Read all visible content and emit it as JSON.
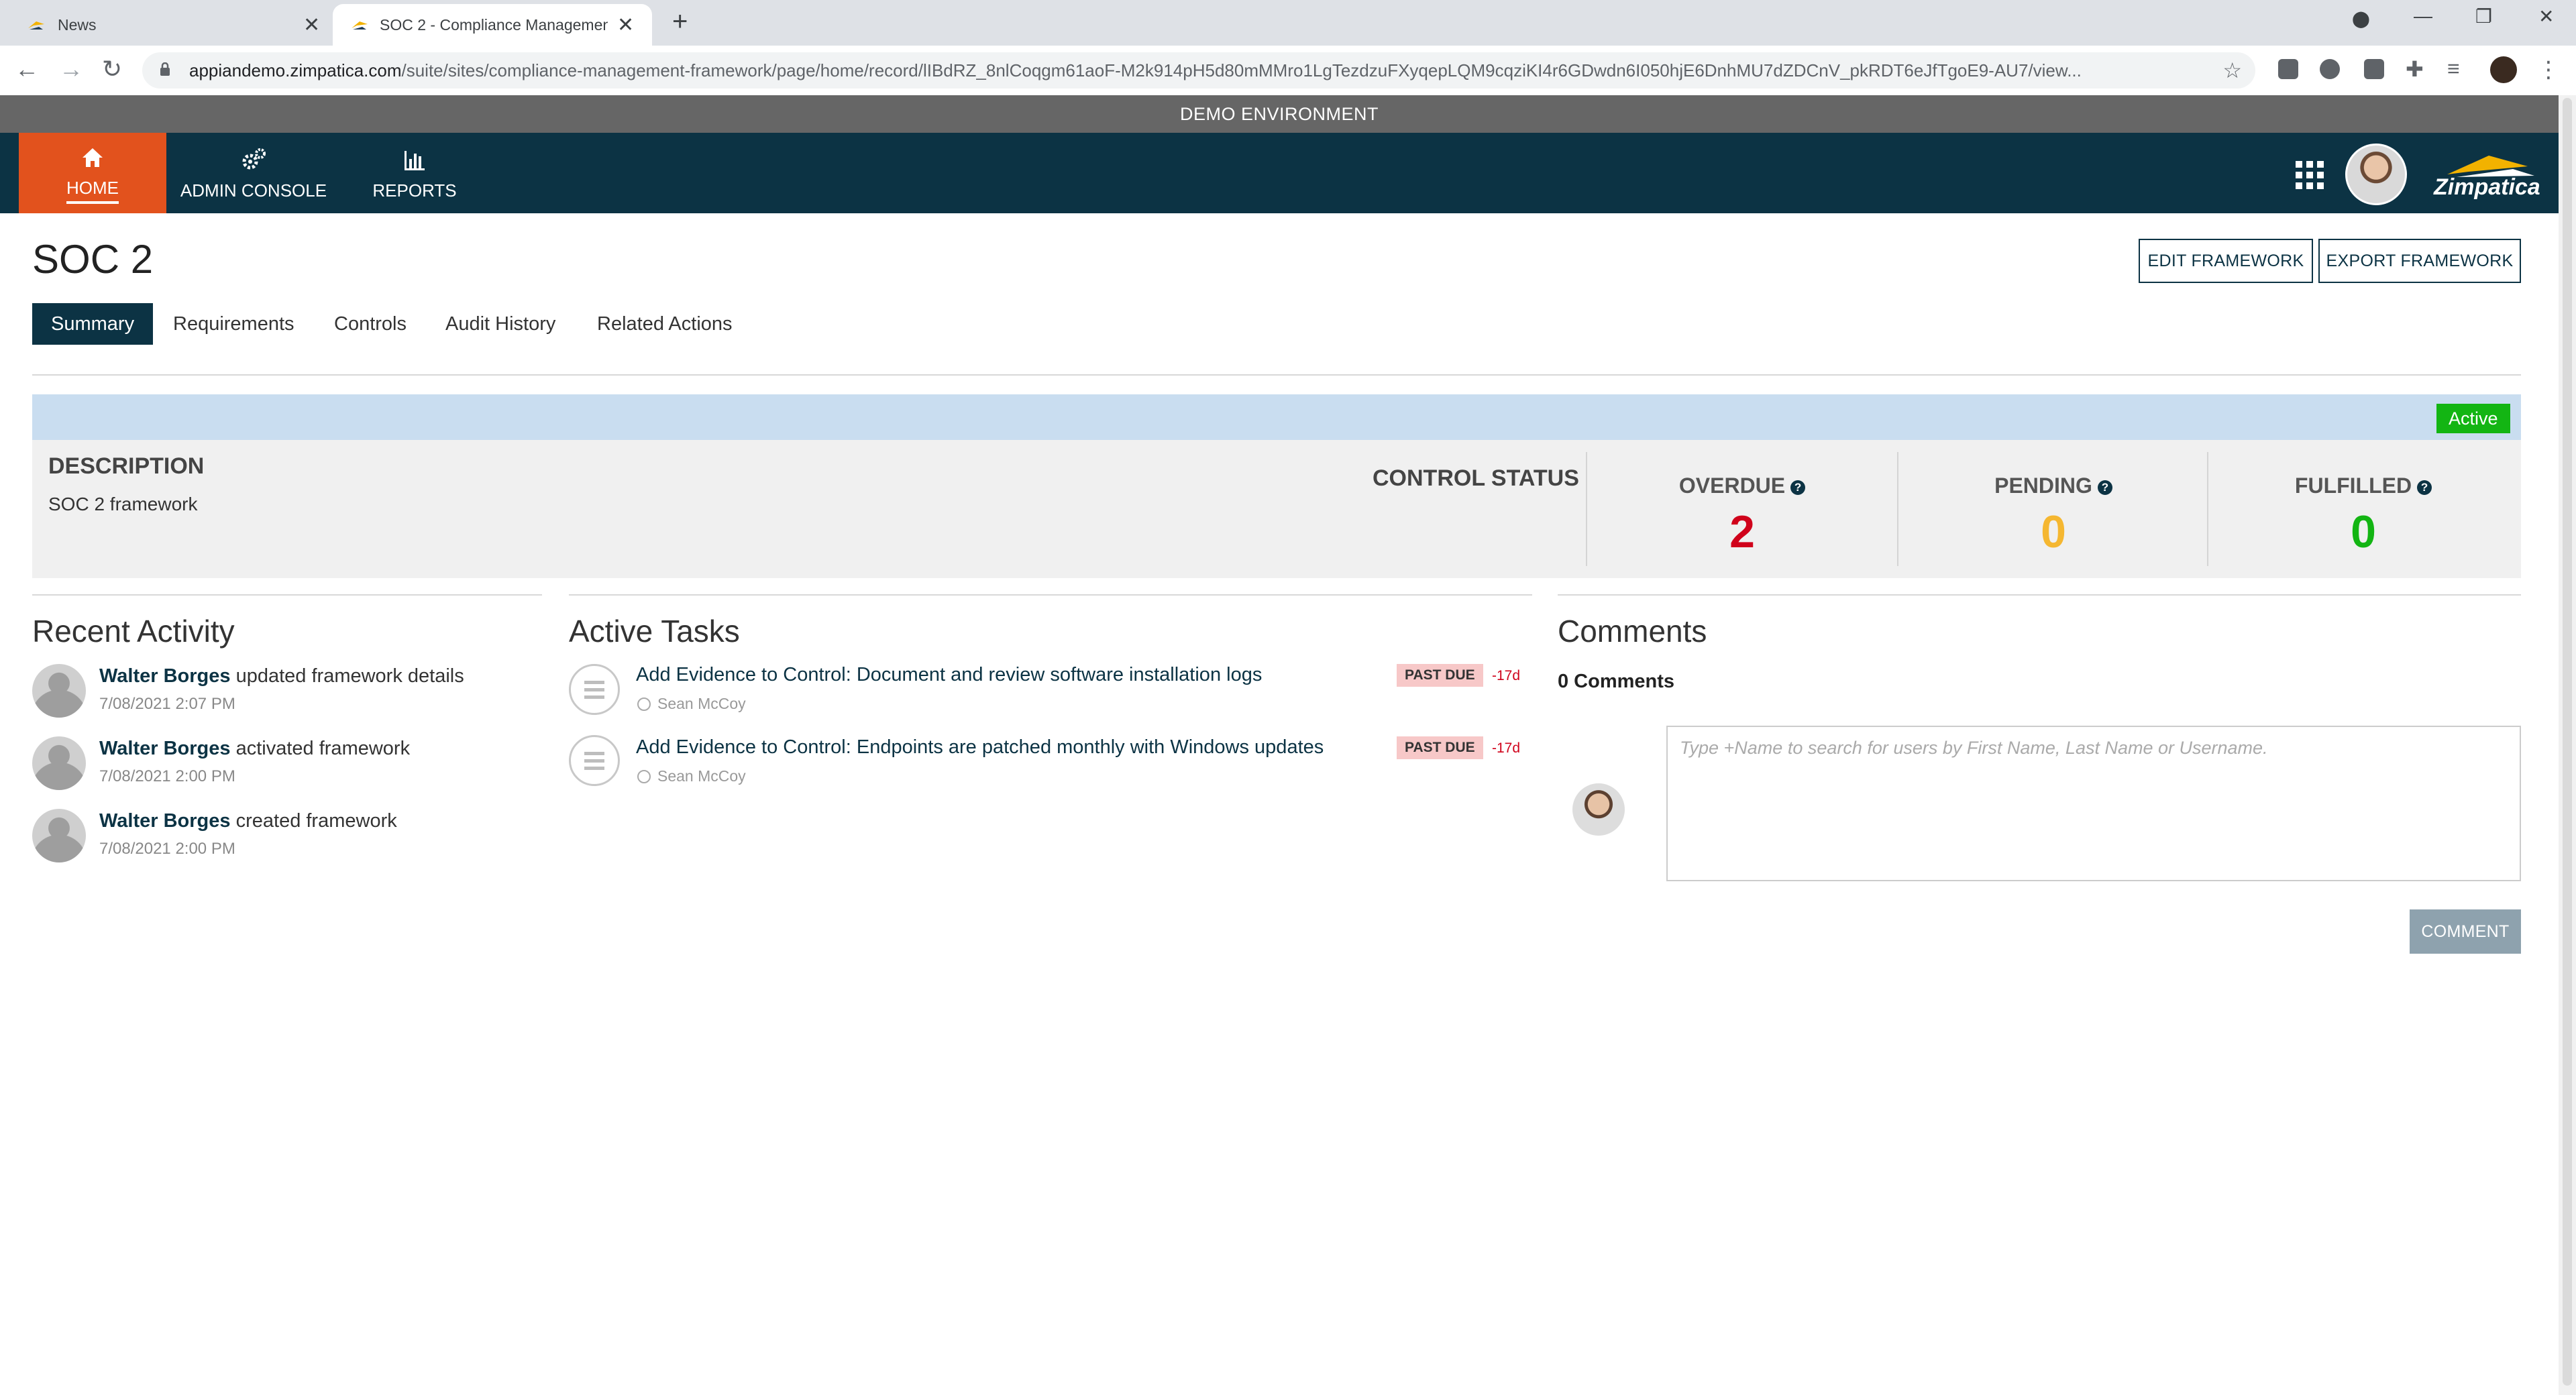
{
  "browser": {
    "tabs": [
      {
        "title": "News",
        "active": false
      },
      {
        "title": "SOC 2 - Compliance Managemen",
        "active": true
      }
    ],
    "new_tab": "+",
    "url_host": "appiandemo.zimpatica.com",
    "url_path": "/suite/sites/compliance-management-framework/page/home/record/lIBdRZ_8nlCoqgm61aoF-M2k914pH5d80mMMro1LgTezdzuFXyqepLQM9cqziKI4r6GDwdn6I050hjE6DnhMU7dZDCnV_pkRDT6eJfTgoE9-AU7/view..."
  },
  "app": {
    "environment_banner": "DEMO ENVIRONMENT",
    "nav": [
      {
        "label": "HOME",
        "icon": "home-icon",
        "active": true
      },
      {
        "label": "ADMIN CONSOLE",
        "icon": "gears-icon",
        "active": false
      },
      {
        "label": "REPORTS",
        "icon": "bar-chart-icon",
        "active": false
      }
    ],
    "logo_text": "Zimpatica",
    "colors": {
      "header": "#0c3344",
      "accent": "#e2521d",
      "overdue": "#d0021b",
      "pending": "#f5b731",
      "fulfilled": "#13b513"
    }
  },
  "page": {
    "title": "SOC 2",
    "actions": {
      "edit": "EDIT FRAMEWORK",
      "export": "EXPORT FRAMEWORK"
    },
    "tabs": [
      "Summary",
      "Requirements",
      "Controls",
      "Audit History",
      "Related Actions"
    ],
    "selected_tab": "Summary",
    "status": "Active",
    "description_label": "DESCRIPTION",
    "description": "SOC 2 framework",
    "control_status_label": "CONTROL STATUS",
    "metrics": [
      {
        "label": "OVERDUE",
        "value": "2",
        "color": "#d0021b"
      },
      {
        "label": "PENDING",
        "value": "0",
        "color": "#f5b731"
      },
      {
        "label": "FULFILLED",
        "value": "0",
        "color": "#13b513"
      }
    ]
  },
  "recent_activity": {
    "title": "Recent Activity",
    "items": [
      {
        "user": "Walter Borges",
        "action": "updated framework details",
        "time": "7/08/2021 2:07 PM"
      },
      {
        "user": "Walter Borges",
        "action": "activated framework",
        "time": "7/08/2021 2:00 PM"
      },
      {
        "user": "Walter Borges",
        "action": "created framework",
        "time": "7/08/2021 2:00 PM"
      }
    ]
  },
  "active_tasks": {
    "title": "Active Tasks",
    "items": [
      {
        "title": "Add Evidence to Control: Document and review software installation logs",
        "assignee": "Sean McCoy",
        "badge": "PAST DUE",
        "days": "-17d"
      },
      {
        "title": "Add Evidence to Control: Endpoints are patched monthly with Windows updates",
        "assignee": "Sean McCoy",
        "badge": "PAST DUE",
        "days": "-17d"
      }
    ]
  },
  "comments": {
    "title": "Comments",
    "count_label": "0 Comments",
    "placeholder": "Type +Name to search for users by First Name, Last Name or Username.",
    "button": "COMMENT"
  }
}
